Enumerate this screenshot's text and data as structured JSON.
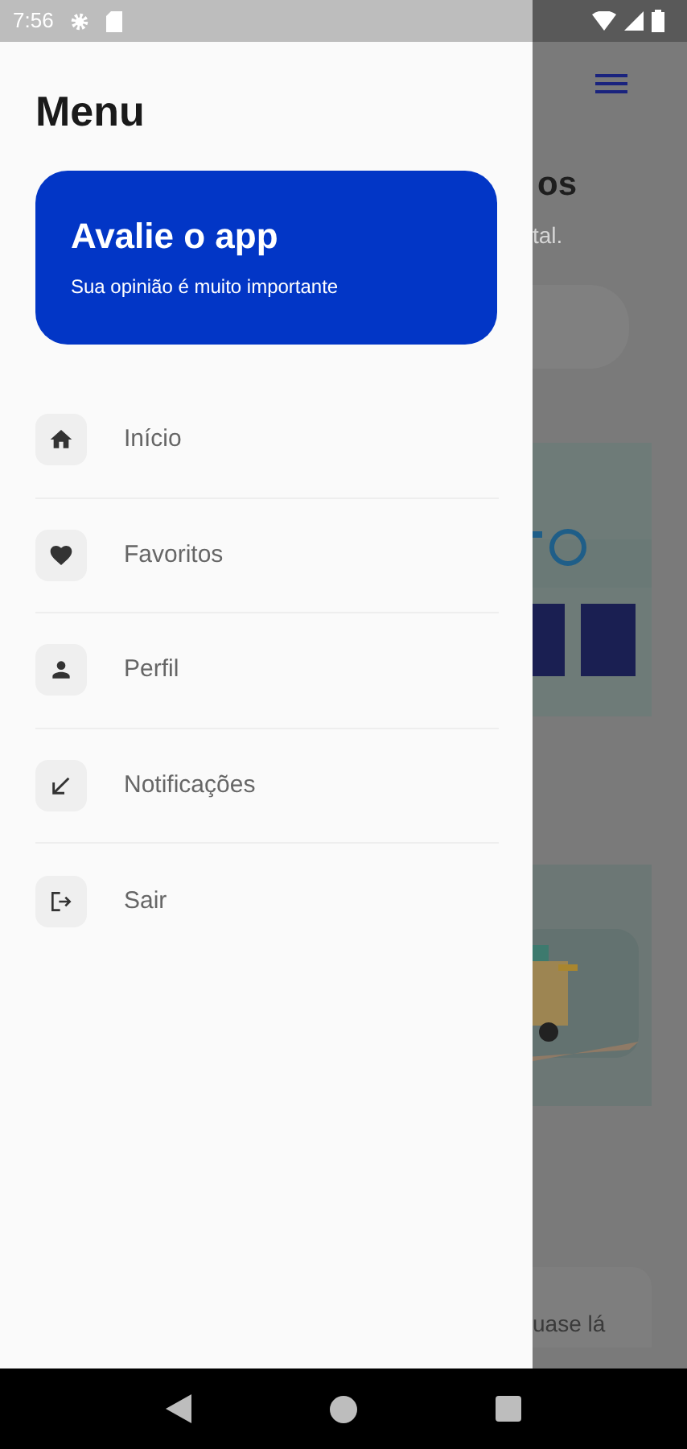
{
  "status_bar": {
    "time": "7:56"
  },
  "drawer": {
    "title": "Menu",
    "rate_card": {
      "title": "Avalie o app",
      "subtitle": "Sua opinião é muito importante"
    },
    "items": [
      {
        "label": "Início",
        "kind": "home"
      },
      {
        "label": "Favoritos",
        "kind": "heart"
      },
      {
        "label": "Perfil",
        "kind": "person"
      },
      {
        "label": "Notificações",
        "kind": "arrow"
      },
      {
        "label": "Sair",
        "kind": "logout"
      }
    ]
  },
  "background": {
    "heading": "os",
    "text": "tal.",
    "card_text": "uase lá"
  }
}
